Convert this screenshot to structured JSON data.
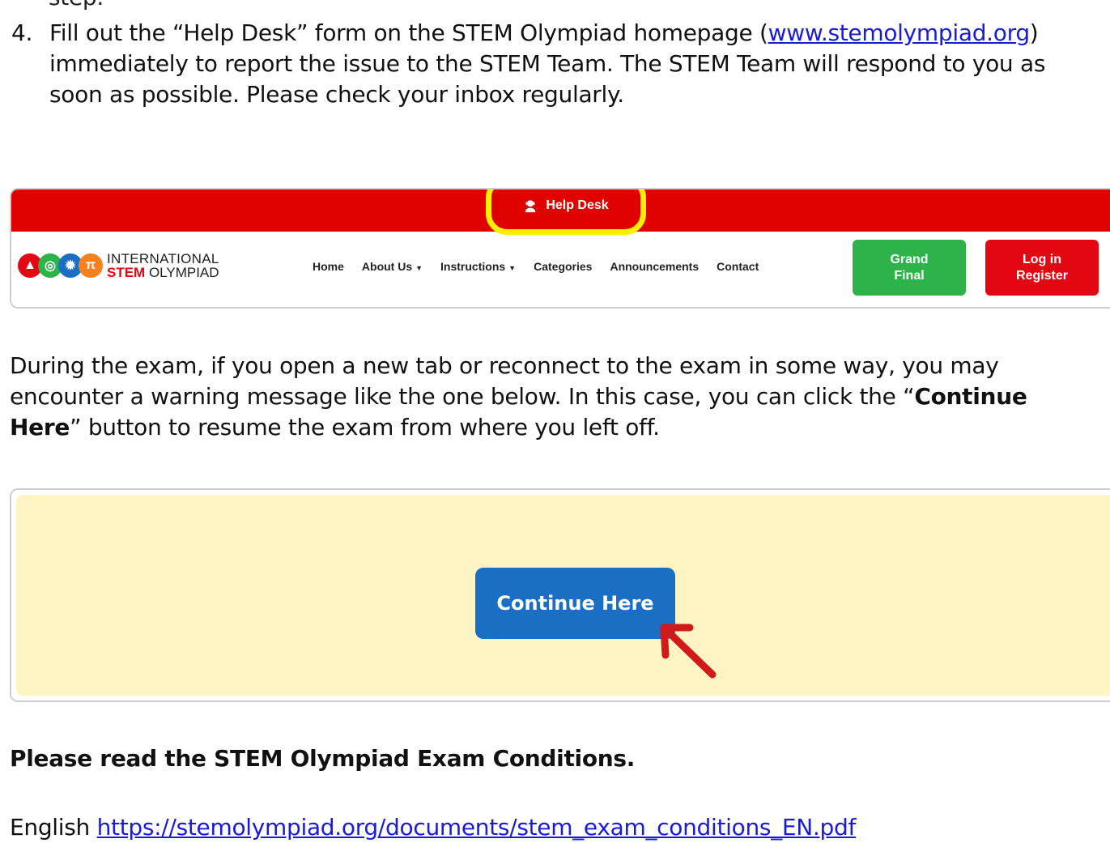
{
  "doc": {
    "clipped_text": "step.",
    "step4_number": "4.",
    "step4_before_link": "Fill out the “Help Desk” form on the STEM Olympiad homepage (",
    "step4_link": "www.stemolympiad.org",
    "step4_after_link": ") immediately to report the issue to the STEM Team. The STEM Team will respond to you as soon as possible. Please check your inbox regularly.",
    "para2_part1": "During the exam, if you open a new tab or reconnect to the exam in some way, you may encounter a warning message like the one below. In this case, you can click the “",
    "para2_bold": "Continue Here",
    "para2_part2": "” button to resume the exam from where you left off.",
    "heading": "Please read the STEM Olympiad Exam Conditions.",
    "english_label": "English ",
    "english_link": "https://stemolympiad.org/documents/stem_exam_conditions_EN.pdf"
  },
  "nav_screenshot": {
    "help_desk": "Help Desk",
    "logo_line1": "INTERNATIONAL",
    "logo_stem": "STEM",
    "logo_olympiad": " OLYMPIAD",
    "links": [
      "Home",
      "About Us",
      "Instructions",
      "Categories",
      "Announcements",
      "Contact"
    ],
    "grand_final_1": "Grand",
    "grand_final_2": "Final",
    "login_1": "Log in",
    "login_2": "Register",
    "colors": {
      "topbar": "#e00000",
      "highlight": "#ffee00",
      "green": "#2db34a",
      "red": "#e30613"
    }
  },
  "continue_screenshot": {
    "button_label": "Continue Here",
    "colors": {
      "panel": "#fff4c4",
      "button": "#1a6fc4",
      "arrow": "#d11a1a"
    }
  }
}
